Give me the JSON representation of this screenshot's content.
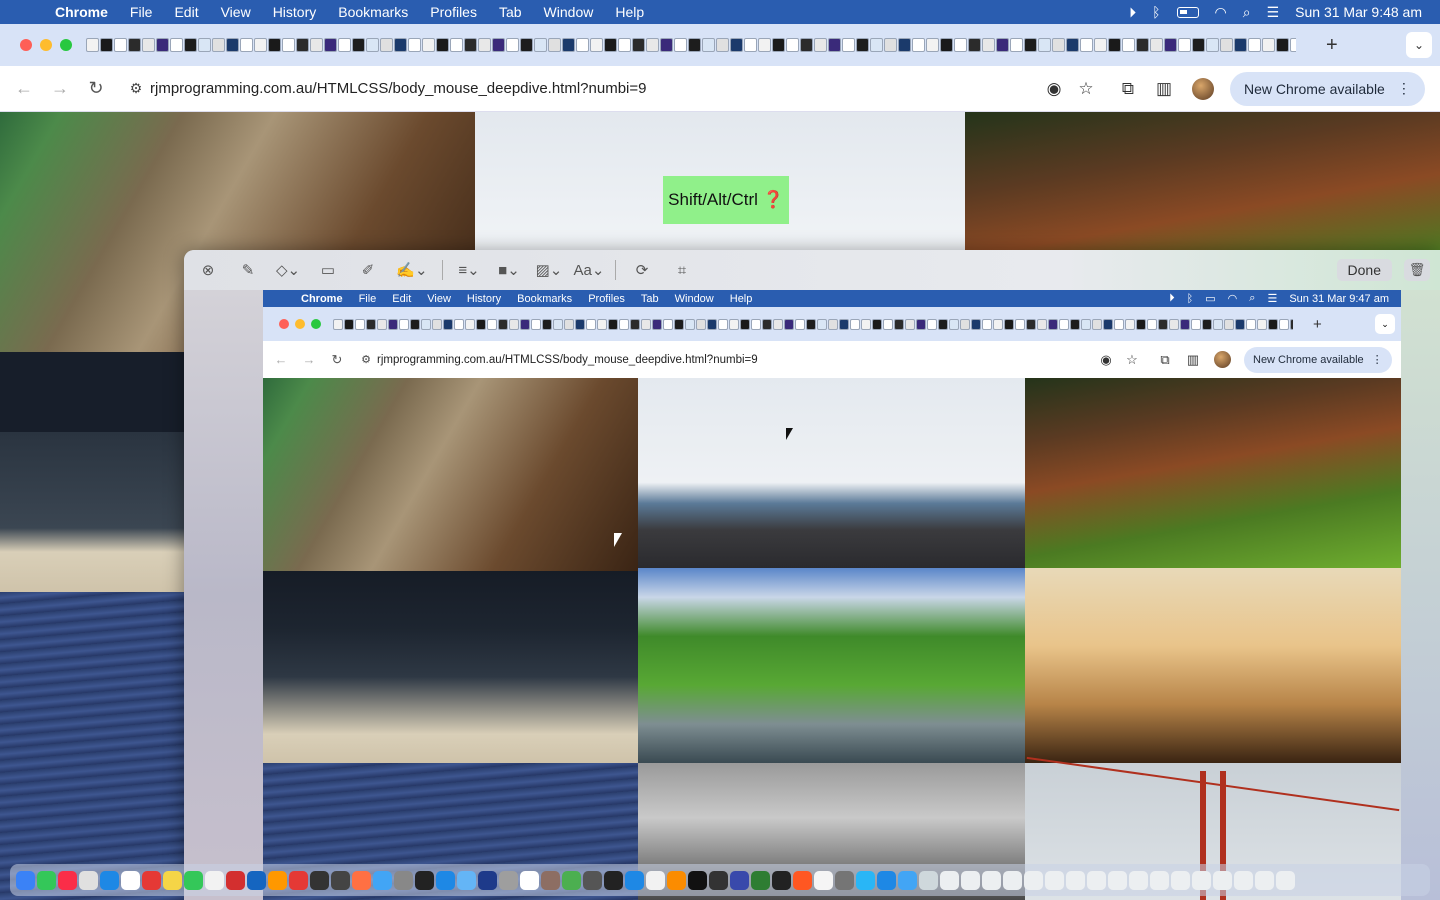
{
  "menubar": {
    "app": "Chrome",
    "items": [
      "File",
      "Edit",
      "View",
      "History",
      "Bookmarks",
      "Profiles",
      "Tab",
      "Window",
      "Help"
    ],
    "datetime": "Sun 31 Mar  9:48 am"
  },
  "browser": {
    "url": "rjmprogramming.com.au/HTMLCSS/body_mouse_deepdive.html?numbi=9",
    "update_label": "New Chrome available",
    "new_tab": "+"
  },
  "page": {
    "hint_text": "Shift/Alt/Ctrl ❓"
  },
  "markup_toolbar": {
    "font_label": "Aa",
    "done_label": "Done"
  },
  "inner_screenshot": {
    "menubar": {
      "app": "Chrome",
      "items": [
        "File",
        "Edit",
        "View",
        "History",
        "Bookmarks",
        "Profiles",
        "Tab",
        "Window",
        "Help"
      ],
      "datetime": "Sun 31 Mar  9:47 am"
    },
    "browser": {
      "url": "rjmprogramming.com.au/HTMLCSS/body_mouse_deepdive.html?numbi=9",
      "update_label": "New Chrome available",
      "new_tab": "+"
    }
  },
  "colors": {
    "menubar": "#2a5db0",
    "tabstrip": "#d8e3f7",
    "hint_bg": "#90f08a"
  },
  "icons": {
    "toolbar": [
      "back-icon",
      "forward-icon",
      "reload-icon",
      "site-settings-icon",
      "eye-icon",
      "star-icon",
      "extensions-icon",
      "sidepanel-icon",
      "profile-avatar",
      "menu-kebab-icon"
    ],
    "markup": [
      "close-icon",
      "sketch-icon",
      "shapes-icon",
      "textbox-icon",
      "highlight-icon",
      "signature-icon",
      "line-style-icon",
      "border-color-icon",
      "fill-color-icon",
      "font-icon",
      "rotate-icon",
      "crop-icon",
      "trash-icon"
    ]
  }
}
